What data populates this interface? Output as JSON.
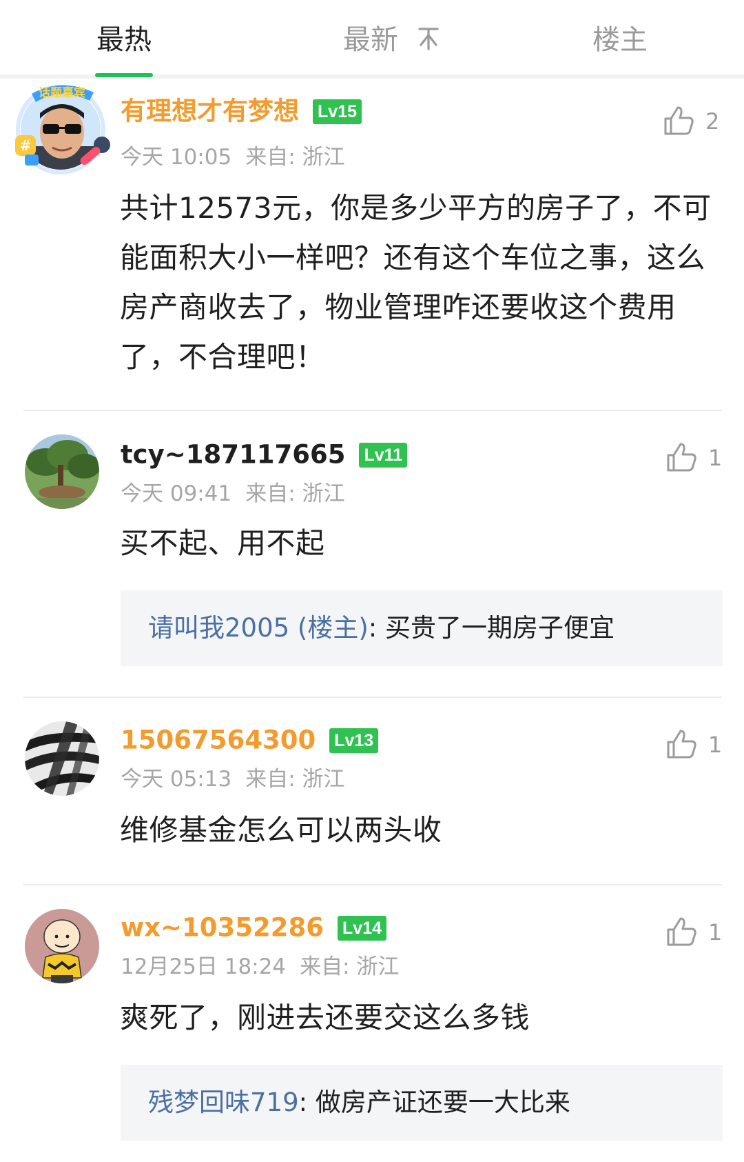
{
  "colors": {
    "accent_green": "#1fbf5a",
    "badge_green": "#2fc251",
    "username_orange": "#f39b2c",
    "username_dark": "#1f1f1f",
    "reply_user_blue": "#4a6fa3"
  },
  "tabs": [
    {
      "label": "最热",
      "active": true
    },
    {
      "label": "最新",
      "icon": "sort-icon",
      "active": false
    },
    {
      "label": "楼主",
      "active": false
    }
  ],
  "comments": [
    {
      "username": "有理想才有梦想",
      "level": "Lv15",
      "time": "今天 10:05",
      "from": "来自: 浙江",
      "content": "共计12573元，你是多少平方的房子了，不可能面积大小一样吧？还有这个车位之事，这么房产商收去了，物业管理咋还要收这个费用了，不合理吧！",
      "likes": "2",
      "avatar": "man-sunglasses-avatar",
      "avatar_badge": "话题嘉宾"
    },
    {
      "username": "tcy~187117665",
      "level": "Lv11",
      "time": "今天 09:41",
      "from": "来自: 浙江",
      "content": "买不起、用不起",
      "likes": "1",
      "avatar": "bonsai-tree-avatar",
      "reply": {
        "user": "请叫我2005 (楼主)",
        "text": "买贵了一期房子便宜"
      }
    },
    {
      "username": "15067564300",
      "level": "Lv13",
      "time": "今天 05:13",
      "from": "来自: 浙江",
      "content": "维修基金怎么可以两头收",
      "likes": "1",
      "avatar": "zebra-pattern-avatar"
    },
    {
      "username": "wx~10352286",
      "level": "Lv14",
      "time": "12月25日 18:24",
      "from": "来自: 浙江",
      "content": "爽死了，刚进去还要交这么多钱",
      "likes": "1",
      "avatar": "cartoon-boy-avatar",
      "reply": {
        "user": "残梦回味719",
        "text": "做房产证还要一大比来"
      }
    }
  ]
}
